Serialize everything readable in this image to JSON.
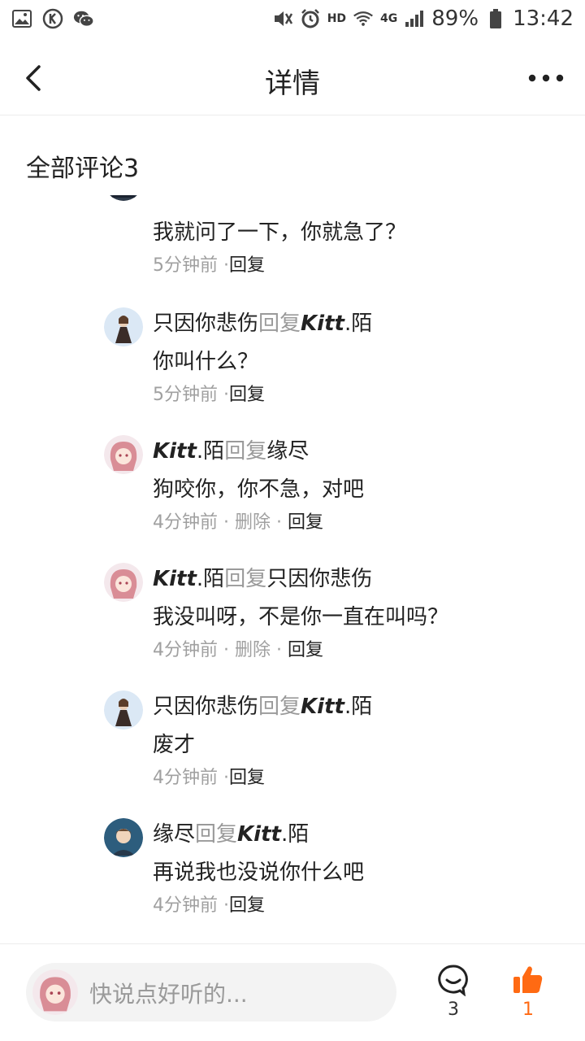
{
  "status_bar": {
    "hd": "HD",
    "net": "4G",
    "battery": "89%",
    "time": "13:42"
  },
  "header": {
    "title": "详情"
  },
  "section": {
    "title": "全部评论3"
  },
  "comments": [
    {
      "avatar": "boy-dark-avatar",
      "author": "",
      "reply_word": "",
      "target": "",
      "text": "我就问了一下，你就急了？",
      "time": "5分钟前",
      "sep": "·",
      "delete": "",
      "reply": "回复"
    },
    {
      "avatar": "girl-cloak-avatar",
      "author": "只因你悲伤",
      "author_italic": false,
      "reply_word": "回复",
      "target": "Kitt",
      "target_suffix": ".陌",
      "text": "你叫什么？",
      "time": "5分钟前",
      "sep": "·",
      "delete": "",
      "reply": "回复"
    },
    {
      "avatar": "pink-hair-avatar",
      "author": "Kitt",
      "author_suffix": ".陌",
      "reply_word": "回复",
      "target": "缘尽",
      "text": "狗咬你，你不急，对吧",
      "time": "4分钟前",
      "sep": " · ",
      "delete": "删除",
      "reply": "回复"
    },
    {
      "avatar": "pink-hair-avatar",
      "author": "Kitt",
      "author_suffix": ".陌",
      "reply_word": "回复",
      "target": "只因你悲伤",
      "text": "我没叫呀，不是你一直在叫吗？",
      "time": "4分钟前",
      "sep": " · ",
      "delete": "删除",
      "reply": "回复"
    },
    {
      "avatar": "girl-cloak-avatar",
      "author": "只因你悲伤",
      "reply_word": "回复",
      "target": "Kitt",
      "target_suffix": ".陌",
      "text": "废才",
      "time": "4分钟前",
      "sep": "·",
      "delete": "",
      "reply": "回复"
    },
    {
      "avatar": "boy-anime-avatar",
      "author": "缘尽",
      "reply_word": "回复",
      "target": "Kitt",
      "target_suffix": ".陌",
      "text": "再说我也没说你什么吧",
      "time": "4分钟前",
      "sep": "·",
      "delete": "",
      "reply": "回复"
    }
  ],
  "bottom": {
    "placeholder": "快说点好听的...",
    "comment_count": "3",
    "like_count": "1"
  },
  "colors": {
    "accent": "#ff6a13",
    "muted": "#9a9a9a"
  }
}
